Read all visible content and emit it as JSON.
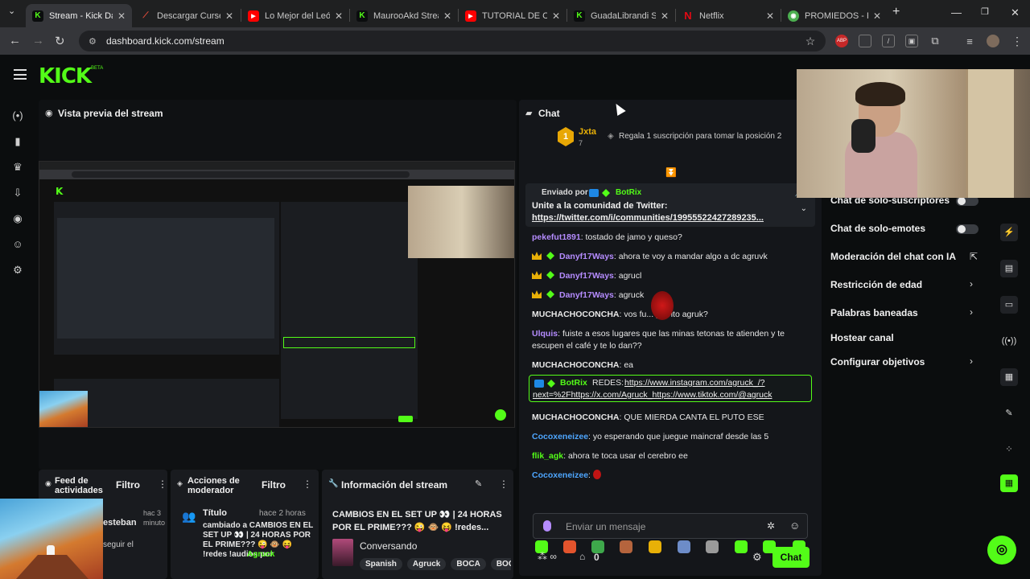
{
  "browser": {
    "tabs": [
      {
        "label": "Stream - Kick Dash",
        "icon": "kick-icon",
        "color": "#53fc18"
      },
      {
        "label": "Descargar Cursed",
        "icon": "cursor-icon",
        "color": "#e04b3a"
      },
      {
        "label": "Lo Mejor del León",
        "icon": "youtube-icon",
        "color": "#ff0000"
      },
      {
        "label": "MaurooAkd Stream",
        "icon": "kick-icon",
        "color": "#53fc18"
      },
      {
        "label": "TUTORIAL DE CÓM",
        "icon": "youtube-icon",
        "color": "#ff0000"
      },
      {
        "label": "GuadaLibrandi Stre",
        "icon": "kick-icon",
        "color": "#53fc18"
      },
      {
        "label": "Netflix",
        "icon": "netflix-icon",
        "color": "#e50914"
      },
      {
        "label": "PROMIEDOS - Fut",
        "icon": "globe-icon",
        "color": "#4caf50"
      }
    ],
    "url": "dashboard.kick.com/stream"
  },
  "kick": {
    "logo": "KICK",
    "beta": "BETA"
  },
  "preview": {
    "title": "Vista previa del stream"
  },
  "chat": {
    "title": "Chat",
    "leader": {
      "rank": "1",
      "name": "Jxta",
      "count": "7"
    },
    "gift_prompt": "Regala 1 suscripción para tomar la posición 2",
    "pinned": {
      "sent_by_label": "Enviado por",
      "sender": "BotRix",
      "message": "Unite a la comunidad de Twitter:",
      "link": "https://twitter.com/i/communities/19955522427289235..."
    },
    "messages": [
      {
        "user": "pekefut1891",
        "text": "tostado de jamo y queso?",
        "color": "#b58cff",
        "badges": ""
      },
      {
        "user": "Danyf17Ways",
        "text": "ahora te voy a mandar algo a dc agruvk",
        "color": "#b58cff",
        "badges": "crown,gem"
      },
      {
        "user": "Danyf17Ways",
        "text": "agrucl",
        "color": "#b58cff",
        "badges": "crown,gem"
      },
      {
        "user": "Danyf17Ways",
        "text": "agruck",
        "color": "#b58cff",
        "badges": "crown,gem"
      },
      {
        "user": "MUCHACHOCONCHA",
        "text": "vos fu... porrito agruk?",
        "color": "#ffffff",
        "badges": ""
      },
      {
        "user": "Ulquis",
        "text": "fuiste a esos lugares que las minas tetonas te atienden y te",
        "color": "#b58cff",
        "badges": ""
      },
      {
        "user": "",
        "text": "escupen el café y te lo dan??",
        "color": "#ffffff",
        "badges": ""
      },
      {
        "user": "MUCHACHOCONCHA",
        "text": "ea",
        "color": "#ffffff",
        "badges": ""
      }
    ],
    "highlight": {
      "user": "BotRix",
      "prefix": "REDES:",
      "link1": "https://www.instagram.com/agruck_/?",
      "link2": "next=%2Fhttps://x.com/Agruck_https://www.tiktok.com/@agruck"
    },
    "messages2": [
      {
        "user": "MUCHACHOCONCHA",
        "text": "QUE MIERDA CANTA EL PUTO ESE",
        "color": "#ffffff"
      },
      {
        "user": "Cocoxeneizee",
        "text": "yo esperando que juegue maincraf desde las 5",
        "color": "#4ea6ff"
      },
      {
        "user": "flik_agk",
        "text": "ahora te toca usar el cerebro ee",
        "color": "#53fc18"
      },
      {
        "user": "Cocoxeneizee",
        "text": "",
        "color": "#4ea6ff"
      }
    ],
    "input_placeholder": "Enviar un mensaje",
    "footer_count": "0",
    "send_label": "Chat"
  },
  "mod_panel": {
    "items": [
      {
        "label": "Chat de solo-suscriptores",
        "control": "toggle"
      },
      {
        "label": "Chat de solo-emotes",
        "control": "toggle"
      },
      {
        "label": "Moderación del chat con IA",
        "control": "external"
      },
      {
        "label": "Restricción de edad",
        "control": "chevron"
      },
      {
        "label": "Palabras baneadas",
        "control": "chevron"
      },
      {
        "label": "Hostear canal",
        "control": "none"
      },
      {
        "label": "Configurar objetivos",
        "control": "chevron"
      }
    ]
  },
  "bottom": {
    "feed": {
      "title": "Feed de actividades",
      "filter": "Filtro",
      "user": "esteban",
      "time": "hac 3 minuto",
      "follow": "seguir el"
    },
    "actions": {
      "title": "Acciones de moderador",
      "filter": "Filtro",
      "item_title": "Título",
      "item_time": "hace 2 horas",
      "item_desc": "cambiado a CAMBIOS EN EL SET UP 👀 | 24 HORAS POR EL PRIME??? 😜 🐵 😝 !redes !audios por",
      "item_author": "Agruck"
    },
    "info": {
      "title": "Información del stream",
      "stream_title": "CAMBIOS EN EL SET UP 👀 | 24 HORAS POR EL PRIME??? 😜 🐵 😝 !redes...",
      "category": "Conversando",
      "tags": [
        "Spanish",
        "Agruck",
        "BOCA",
        "BOC"
      ]
    }
  },
  "colors": {
    "accent": "#53fc18",
    "panel": "#191b1f",
    "background": "#0b0d0e"
  }
}
